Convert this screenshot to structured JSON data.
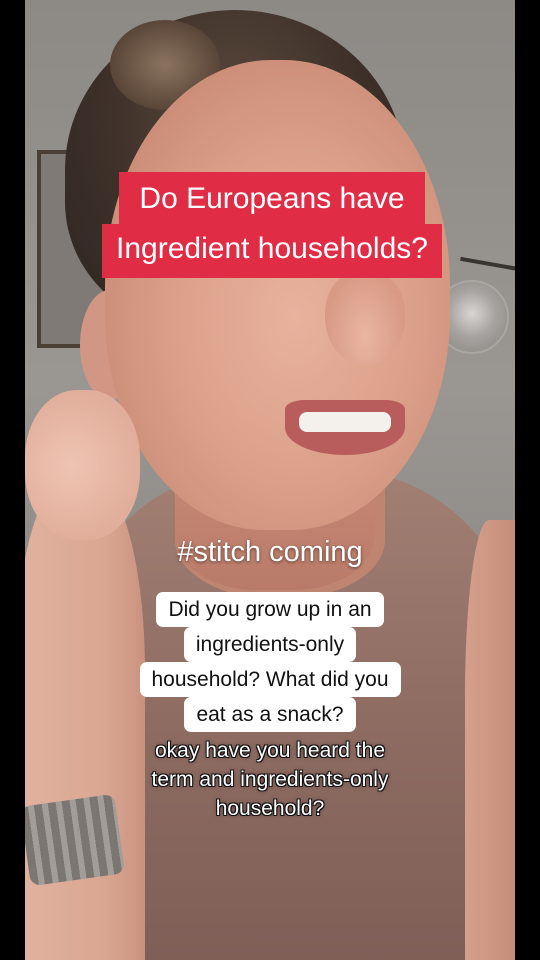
{
  "overlay": {
    "title_lines": [
      "Do Europeans have",
      "Ingredient households?"
    ],
    "stitch_text": "#stitch coming",
    "question_lines": [
      "Did you grow up in an",
      "ingredients-only",
      "household? What did you",
      "eat as a snack?"
    ],
    "subtitle_lines": [
      "okay have you heard the",
      "term and ingredients-only",
      "household?"
    ]
  },
  "colors": {
    "title_bg": "#e02d45",
    "question_bg": "#ffffff",
    "text_light": "#ffffff"
  }
}
